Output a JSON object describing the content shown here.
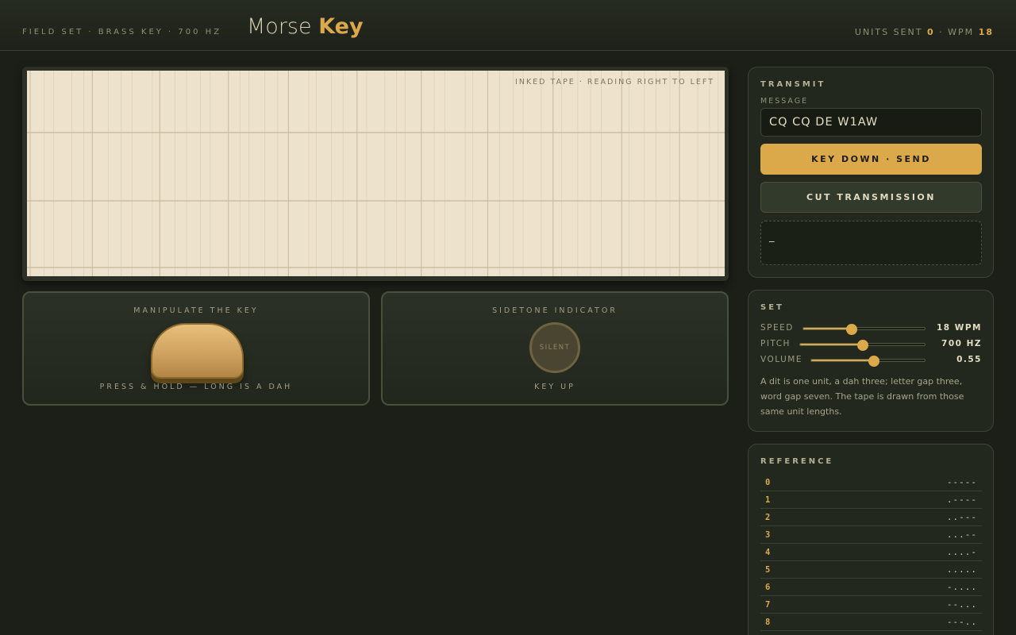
{
  "header": {
    "kicker": "FIELD SET · BRASS KEY · 700 HZ",
    "title_light": "Morse",
    "title_bold": "Key",
    "units_label": "UNITS SENT",
    "units_value": "0",
    "separator": "·",
    "wpm_label": "WPM",
    "wpm_value": "18"
  },
  "tape": {
    "label": "INKED TAPE · READING RIGHT TO LEFT"
  },
  "key_panel": {
    "title": "MANIPULATE THE KEY",
    "hint": "PRESS & HOLD — LONG IS A DAH"
  },
  "tone_panel": {
    "title": "SIDETONE INDICATOR",
    "lamp_text": "SILENT",
    "status": "KEY UP"
  },
  "transmit": {
    "title": "TRANSMIT",
    "message_label": "MESSAGE",
    "message_value": "CQ CQ DE W1AW",
    "send_label": "KEY DOWN · SEND",
    "cut_label": "CUT TRANSMISSION",
    "decoded_text": "_"
  },
  "set": {
    "title": "SET",
    "sliders": [
      {
        "label": "SPEED",
        "value_text": "18 WPM",
        "fraction": 0.4
      },
      {
        "label": "PITCH",
        "value_text": "700 HZ",
        "fraction": 0.5
      },
      {
        "label": "VOLUME",
        "value_text": "0.55",
        "fraction": 0.55
      }
    ],
    "note": "A dit is one unit, a dah three; letter gap three, word gap seven. The tape is drawn from those same unit lengths."
  },
  "reference": {
    "title": "REFERENCE",
    "rows": [
      {
        "char": "0",
        "code": "-----"
      },
      {
        "char": "1",
        "code": ".----"
      },
      {
        "char": "2",
        "code": "..---"
      },
      {
        "char": "3",
        "code": "...--"
      },
      {
        "char": "4",
        "code": "....-"
      },
      {
        "char": "5",
        "code": "....."
      },
      {
        "char": "6",
        "code": "-...."
      },
      {
        "char": "7",
        "code": "--..."
      },
      {
        "char": "8",
        "code": "---.."
      }
    ]
  },
  "colors": {
    "accent": "#dba84a",
    "background": "#1b1f17",
    "tape_paper": "#ede3cd"
  }
}
